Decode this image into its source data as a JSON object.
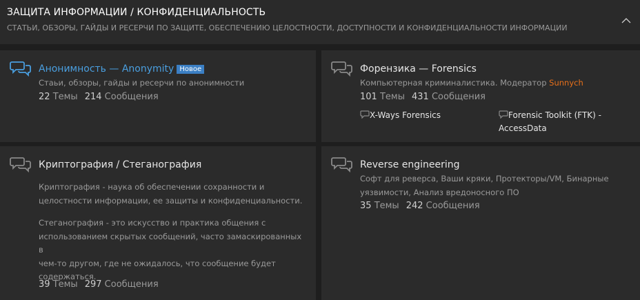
{
  "header": {
    "title": "ЗАЩИТА ИНФОРМАЦИИ / КОНФИДЕНЦИАЛЬНОСТЬ",
    "subtitle": "СТАТЬИ, ОБЗОРЫ, ГАЙДЫ И РЕСЕРЧИ ПО ЗАЩИТЕ, ОБЕСПЕЧЕНИЮ ЦЕЛОСТНОСТИ, ДОСТУПНОСТИ И КОНФИДЕНЦИАЛЬНОСТИ ИНФОРМАЦИИ"
  },
  "forums": {
    "anonymity": {
      "title": "Анонимность — Anonymity",
      "badge": "Новое",
      "desc": "Стаьи, обзоры, гайды и ресерчи по анонимности",
      "threads": "22",
      "threads_label": "Темы",
      "posts": "214",
      "posts_label": "Сообщения"
    },
    "forensics": {
      "title": "Форензика — Forensics",
      "desc": "Компьютерная криминалистика. Модератор",
      "moderator": "Sunnych",
      "threads": "101",
      "threads_label": "Темы",
      "posts": "431",
      "posts_label": "Сообщения",
      "subforums": [
        "X-Ways Forensics",
        "Forensic Toolkit (FTK) -",
        "AccessData"
      ]
    },
    "crypto": {
      "title": "Криптография / Стеганография",
      "desc1_line1": "Криптография - наука об обеспечении сохранности и",
      "desc1_line2": "целостности информации, ее защиты и конфиденциальности.",
      "desc2_line1": "Стеганография - это искусство и практика общения с",
      "desc2_line2": "использованием скрытых сообщений, часто замаскированных в",
      "desc2_line3": "чем-то другом, где не ожидалось, что сообщение будет",
      "desc2_line4": "содержаться.",
      "threads": "39",
      "threads_label": "Темы",
      "posts": "297",
      "posts_label": "Сообщения"
    },
    "reverse": {
      "title": "Reverse engineering",
      "desc_line1": "Софт для реверса, Ваши кряки, Протекторы/VM, Бинарные",
      "desc_line2": "уязвимости, Анализ вредоносного ПО",
      "threads": "35",
      "threads_label": "Темы",
      "posts": "242",
      "posts_label": "Сообщения"
    }
  },
  "colors": {
    "accent": "#4a9fe0",
    "badge": "#3b7fc4",
    "moderator": "#e8701a"
  }
}
